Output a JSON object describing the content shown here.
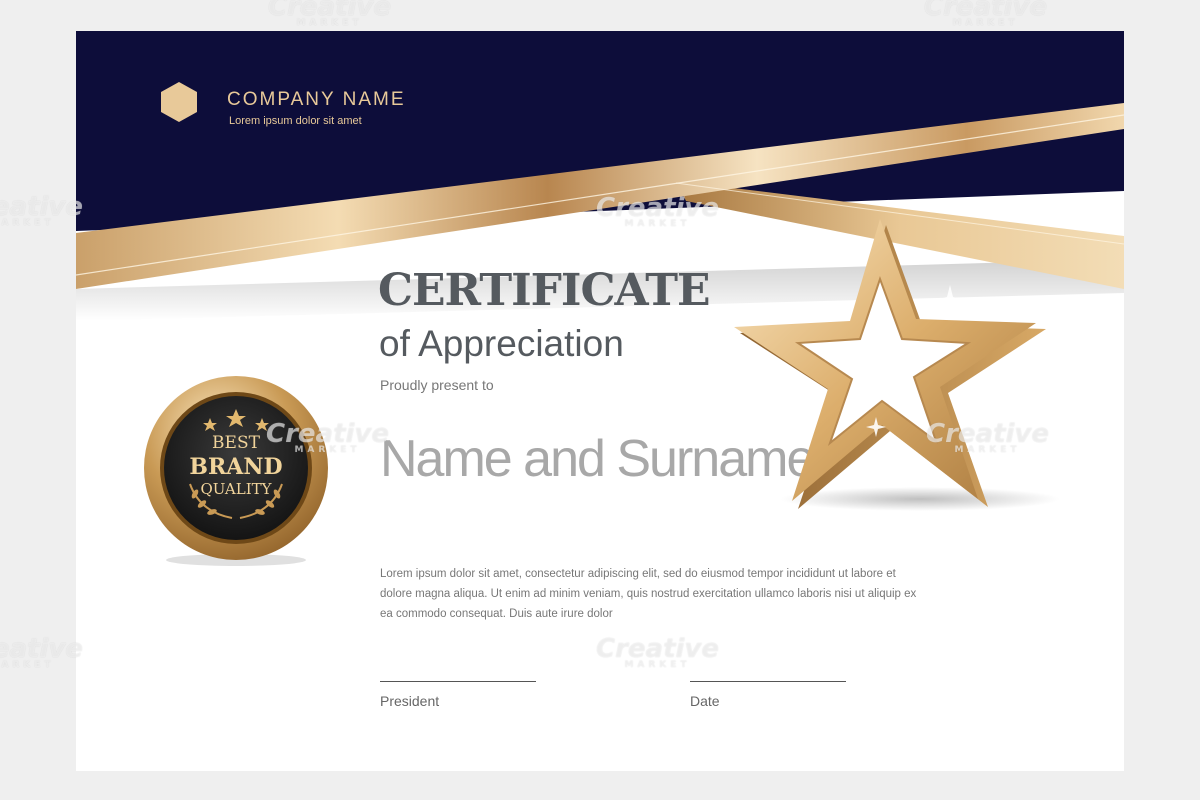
{
  "company": {
    "name": "COMPANY NAME",
    "tagline": "Lorem ipsum dolor sit amet"
  },
  "certificate": {
    "title": "CERTIFICATE",
    "subtitle": "of Appreciation",
    "present_label": "Proudly present to",
    "recipient_placeholder": "Name and Surname",
    "body": "Lorem ipsum dolor sit amet, consectetur adipiscing elit, sed do eiusmod tempor incididunt ut labore et dolore magna aliqua. Ut enim ad minim veniam, quis nostrud exercitation ullamco laboris nisi ut aliquip ex ea commodo consequat. Duis aute irure dolor",
    "signature_left": "President",
    "signature_right": "Date"
  },
  "badge": {
    "line1": "BEST",
    "line2": "BRAND",
    "line3": "QUALITY"
  },
  "watermark": {
    "text": "Creative",
    "sub": "MARKET"
  },
  "colors": {
    "navy": "#0d0d3a",
    "gold": "#d9b07a",
    "gold_light": "#f5dfba",
    "text_dark": "#555a5f",
    "page_bg": "#efefef"
  },
  "icons": {
    "logo": "hexagon-logo-icon",
    "star": "gold-star-icon",
    "badge": "quality-seal-icon"
  }
}
